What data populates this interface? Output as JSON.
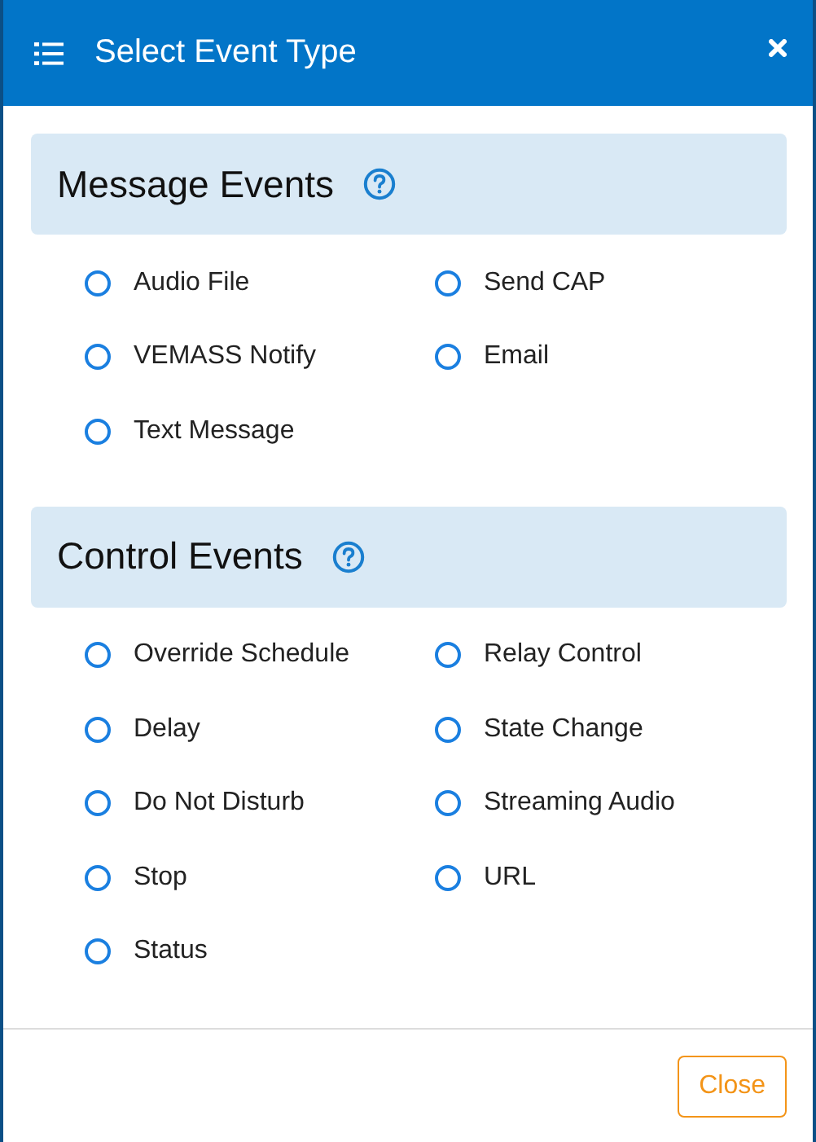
{
  "window": {
    "title": "Select Event Type"
  },
  "sections": [
    {
      "title": "Message Events",
      "options": [
        {
          "label": "Audio File",
          "selected": false
        },
        {
          "label": "Send CAP",
          "selected": false
        },
        {
          "label": "VEMASS Notify",
          "selected": false
        },
        {
          "label": "Email",
          "selected": false
        },
        {
          "label": "Text Message",
          "selected": false
        }
      ]
    },
    {
      "title": "Control Events",
      "options": [
        {
          "label": "Override Schedule",
          "selected": false
        },
        {
          "label": "Relay Control",
          "selected": false
        },
        {
          "label": "Delay",
          "selected": false
        },
        {
          "label": "State Change",
          "selected": false
        },
        {
          "label": "Do Not Disturb",
          "selected": false
        },
        {
          "label": "Streaming Audio",
          "selected": false
        },
        {
          "label": "Stop",
          "selected": false
        },
        {
          "label": "URL",
          "selected": false
        },
        {
          "label": "Status",
          "selected": false
        }
      ]
    }
  ],
  "footer": {
    "buttons": [
      "Close"
    ]
  }
}
